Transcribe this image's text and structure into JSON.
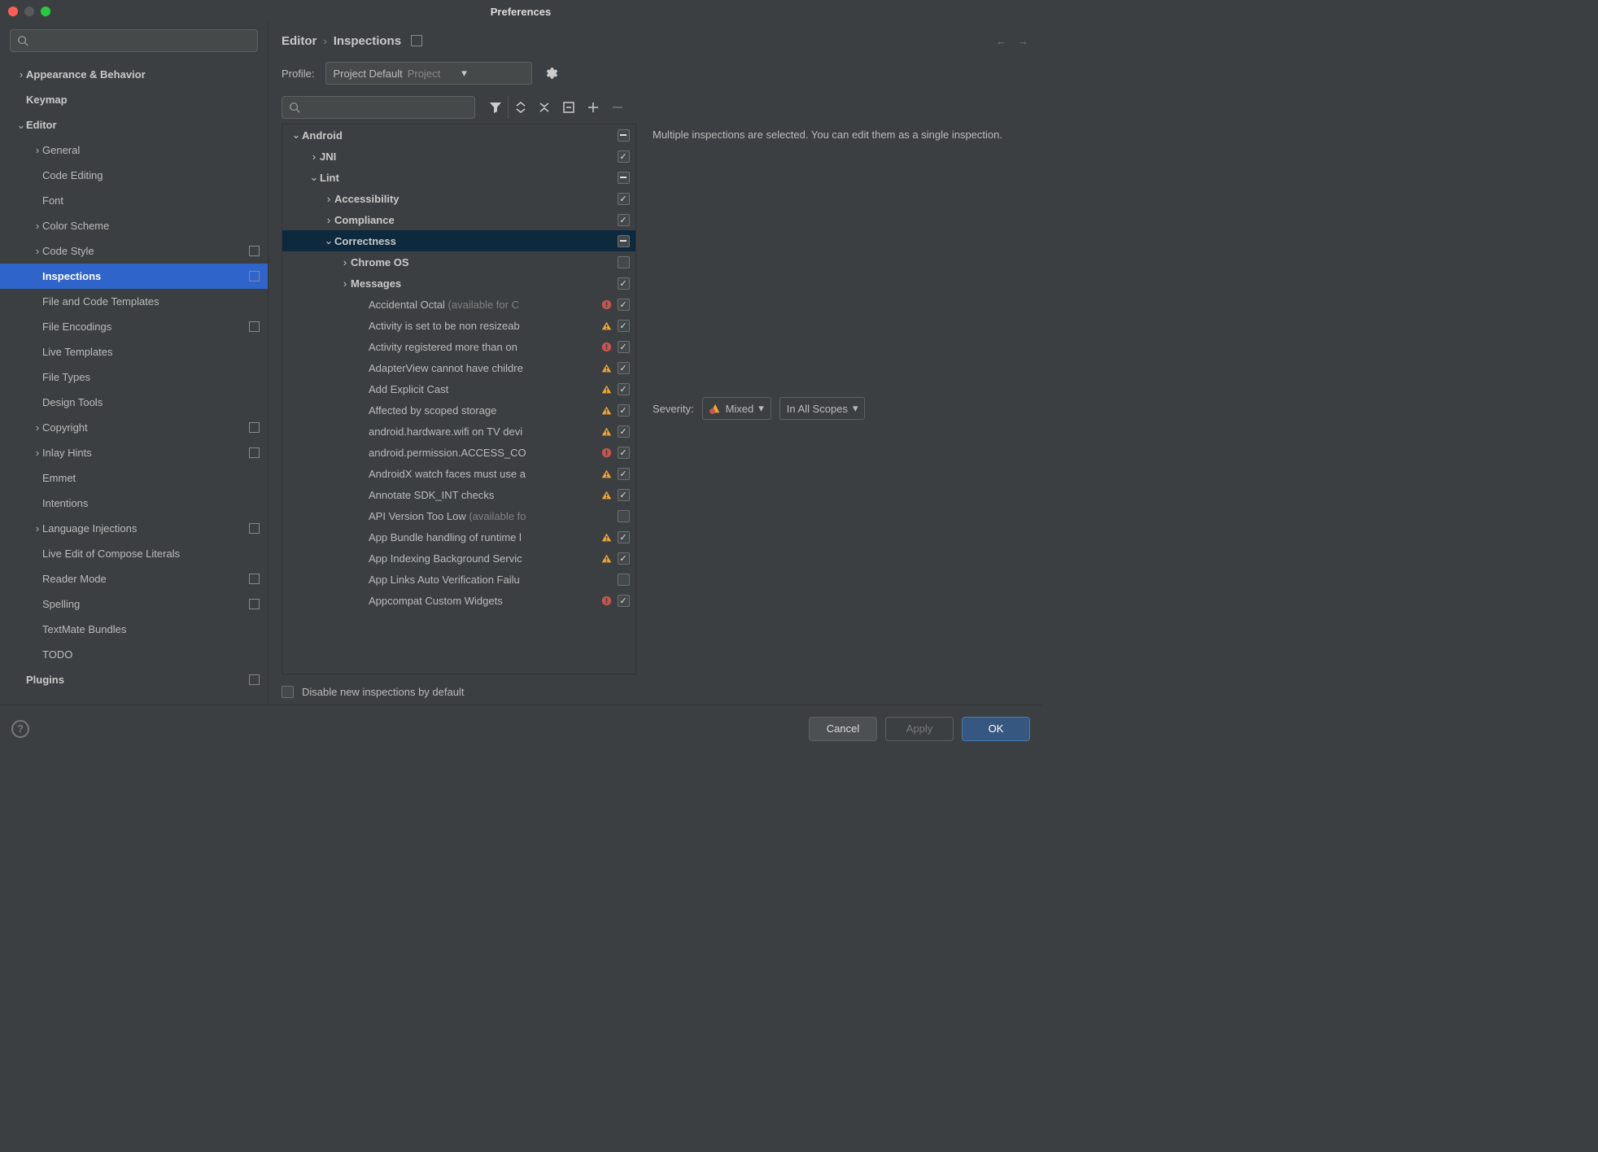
{
  "title": "Preferences",
  "sidebar_search_placeholder": "",
  "sidebar": {
    "items": [
      {
        "label": "Appearance & Behavior",
        "level": 0,
        "bold": true,
        "chev": "right",
        "badge": false
      },
      {
        "label": "Keymap",
        "level": 0,
        "bold": true,
        "chev": "",
        "badge": false
      },
      {
        "label": "Editor",
        "level": 0,
        "bold": true,
        "chev": "down",
        "badge": false
      },
      {
        "label": "General",
        "level": 1,
        "bold": false,
        "chev": "right",
        "badge": false
      },
      {
        "label": "Code Editing",
        "level": 1,
        "bold": false,
        "chev": "",
        "badge": false
      },
      {
        "label": "Font",
        "level": 1,
        "bold": false,
        "chev": "",
        "badge": false
      },
      {
        "label": "Color Scheme",
        "level": 1,
        "bold": false,
        "chev": "right",
        "badge": false
      },
      {
        "label": "Code Style",
        "level": 1,
        "bold": false,
        "chev": "right",
        "badge": true
      },
      {
        "label": "Inspections",
        "level": 1,
        "bold": false,
        "chev": "",
        "badge": true,
        "selected": true
      },
      {
        "label": "File and Code Templates",
        "level": 1,
        "bold": false,
        "chev": "",
        "badge": false
      },
      {
        "label": "File Encodings",
        "level": 1,
        "bold": false,
        "chev": "",
        "badge": true
      },
      {
        "label": "Live Templates",
        "level": 1,
        "bold": false,
        "chev": "",
        "badge": false
      },
      {
        "label": "File Types",
        "level": 1,
        "bold": false,
        "chev": "",
        "badge": false
      },
      {
        "label": "Design Tools",
        "level": 1,
        "bold": false,
        "chev": "",
        "badge": false
      },
      {
        "label": "Copyright",
        "level": 1,
        "bold": false,
        "chev": "right",
        "badge": true
      },
      {
        "label": "Inlay Hints",
        "level": 1,
        "bold": false,
        "chev": "right",
        "badge": true
      },
      {
        "label": "Emmet",
        "level": 1,
        "bold": false,
        "chev": "",
        "badge": false
      },
      {
        "label": "Intentions",
        "level": 1,
        "bold": false,
        "chev": "",
        "badge": false
      },
      {
        "label": "Language Injections",
        "level": 1,
        "bold": false,
        "chev": "right",
        "badge": true
      },
      {
        "label": "Live Edit of Compose Literals",
        "level": 1,
        "bold": false,
        "chev": "",
        "badge": false
      },
      {
        "label": "Reader Mode",
        "level": 1,
        "bold": false,
        "chev": "",
        "badge": true
      },
      {
        "label": "Spelling",
        "level": 1,
        "bold": false,
        "chev": "",
        "badge": true
      },
      {
        "label": "TextMate Bundles",
        "level": 1,
        "bold": false,
        "chev": "",
        "badge": false
      },
      {
        "label": "TODO",
        "level": 1,
        "bold": false,
        "chev": "",
        "badge": false
      },
      {
        "label": "Plugins",
        "level": 0,
        "bold": true,
        "chev": "",
        "badge": true
      }
    ]
  },
  "breadcrumb": {
    "a": "Editor",
    "b": "Inspections"
  },
  "profile": {
    "label": "Profile:",
    "value": "Project Default",
    "scope": "Project"
  },
  "insp_search_placeholder": "",
  "inspection_tree": [
    {
      "level": 0,
      "chev": "down",
      "bold": true,
      "text": "Android",
      "cb": "mixed"
    },
    {
      "level": 1,
      "chev": "right",
      "bold": true,
      "text": "JNI",
      "cb": "checked"
    },
    {
      "level": 1,
      "chev": "down",
      "bold": true,
      "text": "Lint",
      "cb": "mixed"
    },
    {
      "level": 2,
      "chev": "right",
      "bold": true,
      "text": "Accessibility",
      "cb": "checked"
    },
    {
      "level": 2,
      "chev": "right",
      "bold": true,
      "text": "Compliance",
      "cb": "checked"
    },
    {
      "level": 2,
      "chev": "down",
      "bold": true,
      "text": "Correctness",
      "cb": "mixed",
      "selected": true
    },
    {
      "level": 3,
      "chev": "right",
      "bold": true,
      "text": "Chrome OS",
      "cb": "empty"
    },
    {
      "level": 3,
      "chev": "right",
      "bold": true,
      "text": "Messages",
      "cb": "checked"
    },
    {
      "level": 4,
      "chev": "",
      "bold": false,
      "text": "Accidental Octal",
      "suffix": " (available for C",
      "sev": "err",
      "cb": "checked"
    },
    {
      "level": 4,
      "chev": "",
      "bold": false,
      "text": "Activity is set to be non resizeab",
      "sev": "warn",
      "cb": "checked"
    },
    {
      "level": 4,
      "chev": "",
      "bold": false,
      "text": "Activity registered more than on",
      "sev": "err",
      "cb": "checked"
    },
    {
      "level": 4,
      "chev": "",
      "bold": false,
      "text": "AdapterView cannot have childre",
      "sev": "warn",
      "cb": "checked"
    },
    {
      "level": 4,
      "chev": "",
      "bold": false,
      "text": "Add Explicit Cast",
      "sev": "warn",
      "cb": "checked"
    },
    {
      "level": 4,
      "chev": "",
      "bold": false,
      "text": "Affected by scoped storage",
      "sev": "warn",
      "cb": "checked"
    },
    {
      "level": 4,
      "chev": "",
      "bold": false,
      "text": "android.hardware.wifi on TV devi",
      "sev": "warn",
      "cb": "checked"
    },
    {
      "level": 4,
      "chev": "",
      "bold": false,
      "text": "android.permission.ACCESS_CO",
      "sev": "err",
      "cb": "checked"
    },
    {
      "level": 4,
      "chev": "",
      "bold": false,
      "text": "AndroidX watch faces must use a",
      "sev": "warn",
      "cb": "checked"
    },
    {
      "level": 4,
      "chev": "",
      "bold": false,
      "text": "Annotate SDK_INT checks",
      "sev": "warn",
      "cb": "checked"
    },
    {
      "level": 4,
      "chev": "",
      "bold": false,
      "text": "API Version Too Low",
      "suffix": " (available fo",
      "sev": "",
      "cb": "empty"
    },
    {
      "level": 4,
      "chev": "",
      "bold": false,
      "text": "App Bundle handling of runtime l",
      "sev": "warn",
      "cb": "checked"
    },
    {
      "level": 4,
      "chev": "",
      "bold": false,
      "text": "App Indexing Background Servic",
      "sev": "warn",
      "cb": "checked"
    },
    {
      "level": 4,
      "chev": "",
      "bold": false,
      "text": "App Links Auto Verification Failu",
      "sev": "",
      "cb": "empty"
    },
    {
      "level": 4,
      "chev": "",
      "bold": false,
      "text": "Appcompat Custom Widgets",
      "sev": "err",
      "cb": "checked"
    }
  ],
  "detail_msg": "Multiple inspections are selected. You can edit them as a single inspection.",
  "severity": {
    "label": "Severity:",
    "value": "Mixed",
    "scope": "In All Scopes"
  },
  "disable_label": "Disable new inspections by default",
  "buttons": {
    "cancel": "Cancel",
    "apply": "Apply",
    "ok": "OK"
  }
}
